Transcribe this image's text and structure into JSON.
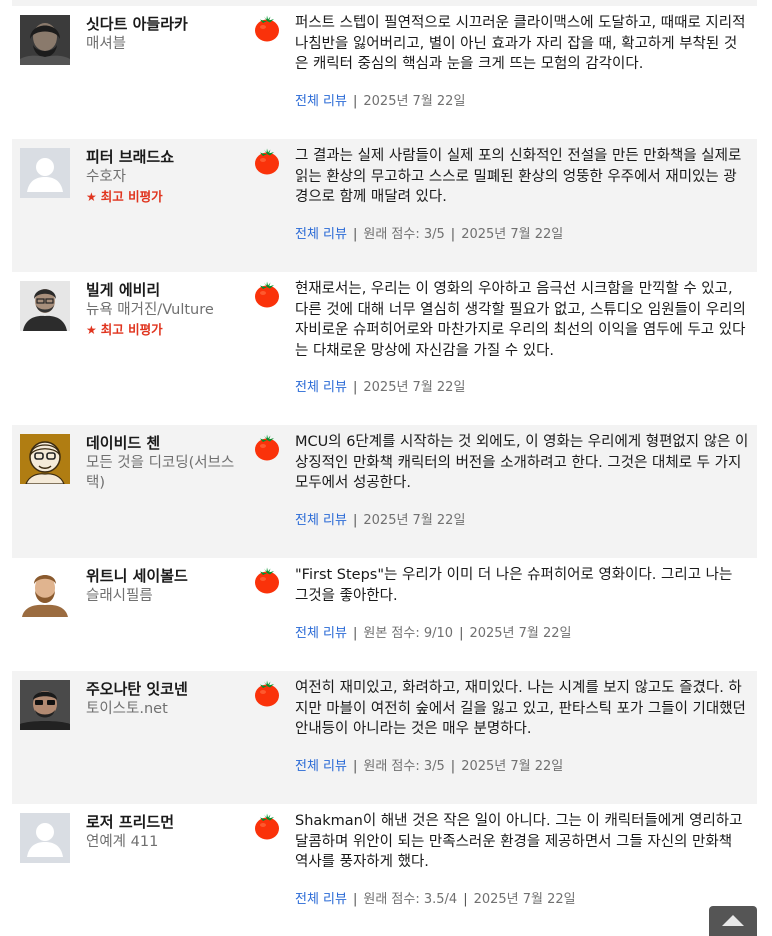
{
  "reviews": [
    {
      "critic": "싯다트 아들라카",
      "publication": "매셔블",
      "top_critic": "",
      "avatar": "photo-avatar",
      "quote": "퍼스트 스텝이 필연적으로 시끄러운 클라이맥스에 도달하고, 때때로 지리적 나침반을 잃어버리고, 별이 아닌 효과가 자리 잡을 때, 확고하게 부착된 것은 캐릭터 중심의 핵심과 눈을 크게 뜨는 모험의 감각이다.",
      "full_review": "전체 리뷰",
      "score": "",
      "date": "2025년 7월 22일",
      "score_icon": "fresh-tomato-icon"
    },
    {
      "critic": "피터 브래드쇼",
      "publication": "수호자",
      "top_critic": "최고 비평가",
      "avatar": "default-avatar",
      "quote": "그 결과는 실제 사람들이 실제 포의 신화적인 전설을 만든 만화책을 실제로 읽는 환상의 무고하고 스스로 밀폐된 환상의 엉뚱한 우주에서 재미있는 광경으로 함께 매달려 있다.",
      "full_review": "전체 리뷰",
      "score": "원래 점수: 3/5",
      "date": "2025년 7월 22일",
      "score_icon": "fresh-tomato-icon"
    },
    {
      "critic": "빌게 에비리",
      "publication": "뉴욕 매거진/Vulture",
      "top_critic": "최고 비평가",
      "avatar": "photo-avatar",
      "quote": "현재로서는, 우리는 이 영화의 우아하고 음극선 시크함을 만끽할 수 있고, 다른 것에 대해 너무 열심히 생각할 필요가 없고, 스튜디오 임원들이 우리의 자비로운 슈퍼히어로와 마찬가지로 우리의 최선의 이익을 염두에 두고 있다는 다채로운 망상에 자신감을 가질 수 있다.",
      "full_review": "전체 리뷰",
      "score": "",
      "date": "2025년 7월 22일",
      "score_icon": "fresh-tomato-icon"
    },
    {
      "critic": "데이비드 첸",
      "publication": "모든 것을 디코딩(서브스택)",
      "top_critic": "",
      "avatar": "illustrated-avatar",
      "quote": "MCU의 6단계를 시작하는 것 외에도, 이 영화는 우리에게 형편없지 않은 이 상징적인 만화책 캐릭터의 버전을 소개하려고 한다. 그것은 대체로 두 가지 모두에서 성공한다.",
      "full_review": "전체 리뷰",
      "score": "",
      "date": "2025년 7월 22일",
      "score_icon": "fresh-tomato-icon"
    },
    {
      "critic": "위트니 세이볼드",
      "publication": "슬래시필름",
      "top_critic": "",
      "avatar": "photo-avatar",
      "quote": "\"First Steps\"는 우리가 이미 더 나은 슈퍼히어로 영화이다. 그리고 나는 그것을 좋아한다.",
      "full_review": "전체 리뷰",
      "score": "원본 점수: 9/10",
      "date": "2025년 7월 22일",
      "score_icon": "fresh-tomato-icon"
    },
    {
      "critic": "주오나탄 잇코넨",
      "publication": "토이스토.net",
      "top_critic": "",
      "avatar": "photo-avatar",
      "quote": "여전히 재미있고, 화려하고, 재미있다. 나는 시계를 보지 않고도 즐겼다. 하지만 마블이 여전히 숲에서 길을 잃고 있고, 판타스틱 포가 그들이 기대했던 안내등이 아니라는 것은 매우 분명하다.",
      "full_review": "전체 리뷰",
      "score": "원래 점수: 3/5",
      "date": "2025년 7월 22일",
      "score_icon": "fresh-tomato-icon"
    },
    {
      "critic": "로저 프리드먼",
      "publication": "연예계 411",
      "top_critic": "",
      "avatar": "default-avatar",
      "quote": "Shakman이 해낸 것은 작은 일이 아니다. 그는 이 캐릭터들에게 영리하고 달콤하며 위안이 되는 만족스러운 환경을 제공하면서 그들 자신의 만화책 역사를 풍자하게 했다.",
      "full_review": "전체 리뷰",
      "score": "원래 점수: 3.5/4",
      "date": "2025년 7월 22일",
      "score_icon": "fresh-tomato-icon"
    }
  ],
  "back_to_top_icon": "chevron-up-icon",
  "colors": {
    "link": "#2a6ad6",
    "top_critic": "#e0341e",
    "tomato": "#fa320a",
    "row_shade": "#f3f3f3"
  }
}
